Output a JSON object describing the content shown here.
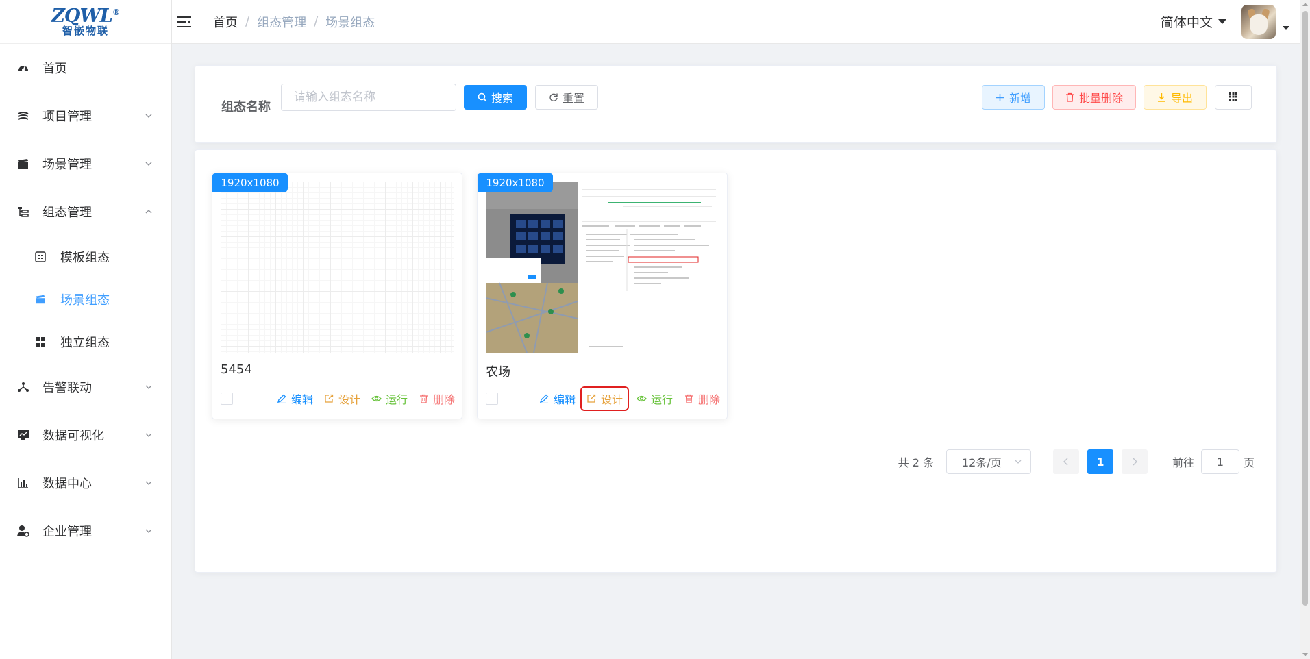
{
  "brand": {
    "logo_top": "ZQWL",
    "logo_reg": "®",
    "logo_bottom": "智嵌物联"
  },
  "sidebar": {
    "items": [
      {
        "label": "首页",
        "icon": "dashboard-icon"
      },
      {
        "label": "项目管理",
        "icon": "stack-icon"
      },
      {
        "label": "场景管理",
        "icon": "clapper-icon"
      },
      {
        "label": "组态管理",
        "icon": "tree-list-icon"
      },
      {
        "label": "告警联动",
        "icon": "share-icon"
      },
      {
        "label": "数据可视化",
        "icon": "monitor-chart-icon"
      },
      {
        "label": "数据中心",
        "icon": "bar-chart-icon"
      },
      {
        "label": "企业管理",
        "icon": "user-gear-icon"
      }
    ],
    "submenu": [
      {
        "label": "模板组态",
        "icon": "calendar-icon"
      },
      {
        "label": "场景组态",
        "icon": "clapper-icon"
      },
      {
        "label": "独立组态",
        "icon": "grid-icon"
      }
    ]
  },
  "header": {
    "breadcrumb": [
      "首页",
      "组态管理",
      "场景组态"
    ],
    "breadcrumb_sep": "/",
    "language": "简体中文"
  },
  "search": {
    "label": "组态名称",
    "placeholder": "请输入组态名称",
    "value": "",
    "search_btn": "搜索",
    "reset_btn": "重置",
    "add_btn": "新增",
    "batch_delete_btn": "批量删除",
    "export_btn": "导出"
  },
  "cards": [
    {
      "resolution": "1920x1080",
      "name": "5454",
      "actions": {
        "edit": "编辑",
        "design": "设计",
        "run": "运行",
        "delete": "删除"
      }
    },
    {
      "resolution": "1920x1080",
      "name": "农场",
      "actions": {
        "edit": "编辑",
        "design": "设计",
        "run": "运行",
        "delete": "删除"
      }
    }
  ],
  "pagination": {
    "total_text": "共 2 条",
    "page_size": "12条/页",
    "current_page": "1",
    "goto_label": "前往",
    "goto_value": "1",
    "page_suffix": "页"
  },
  "colors": {
    "primary": "#1890ff",
    "design": "#e6a23c",
    "run": "#67c23a",
    "delete": "#f56c6c",
    "highlight": "#e02020"
  }
}
